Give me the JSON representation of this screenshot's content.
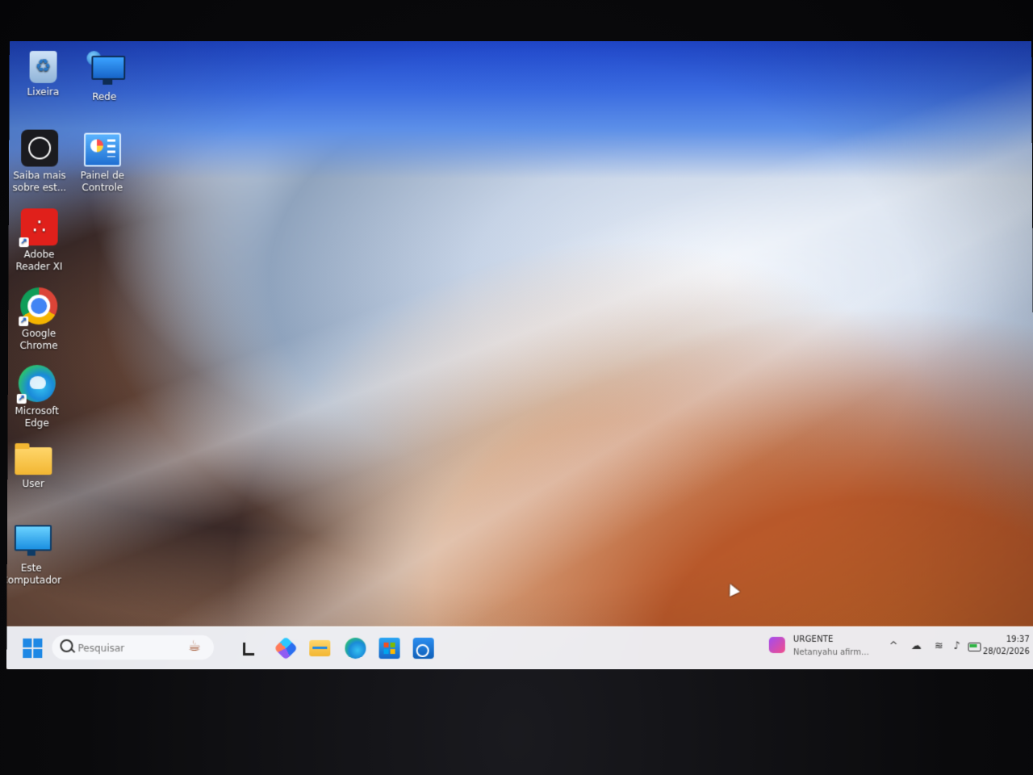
{
  "desktop": {
    "icons": [
      {
        "label": "Lixeira",
        "icon": "recycle-bin-icon"
      },
      {
        "label": "Rede",
        "icon": "network-icon"
      },
      {
        "label": "Saiba mais sobre est...",
        "icon": "learn-more-icon"
      },
      {
        "label": "Painel de Controle",
        "icon": "control-panel-icon"
      },
      {
        "label": "Adobe Reader XI",
        "icon": "adobe-reader-icon"
      },
      {
        "label": "Google Chrome",
        "icon": "chrome-icon"
      },
      {
        "label": "Microsoft Edge",
        "icon": "edge-icon"
      },
      {
        "label": "User",
        "icon": "folder-icon"
      },
      {
        "label": "Este Computador",
        "icon": "this-pc-icon"
      }
    ]
  },
  "taskbar": {
    "search": {
      "placeholder": "Pesquisar"
    },
    "apps": [
      "widgets-icon",
      "copilot-icon",
      "file-explorer-icon",
      "edge-icon",
      "store-icon",
      "outlook-icon"
    ],
    "news": {
      "title": "URGENTE",
      "subtitle": "Netanyahu afirm..."
    },
    "tray": [
      "chevron-up-icon",
      "cloud-off-icon",
      "wifi-icon",
      "volume-icon",
      "battery-icon"
    ],
    "clock": {
      "time": "19:37",
      "date": "28/02/2026"
    }
  },
  "colors": {
    "taskbar_bg": "#eef0f6",
    "accent": "#1e88e5"
  }
}
